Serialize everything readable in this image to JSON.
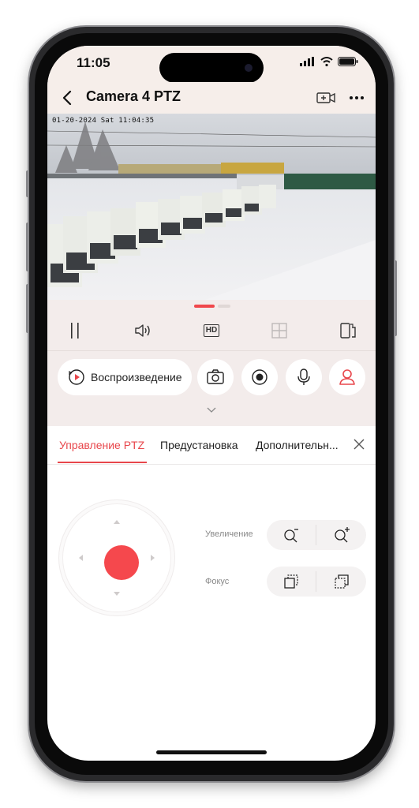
{
  "status_bar": {
    "time": "11:05"
  },
  "header": {
    "back_icon": "chevron-left-icon",
    "title": "Camera 4 PTZ",
    "video_add_icon": "video-plus-icon",
    "more_icon": "more-icon"
  },
  "video": {
    "osd_timestamp": "01-20-2024 Sat 11:04:35"
  },
  "toolbar": {
    "pause_icon": "pause-icon",
    "sound_icon": "speaker-icon",
    "quality_label": "HD",
    "split_icon": "grid-icon",
    "rotate_icon": "device-rotate-icon"
  },
  "actions": {
    "playback_label": "Воспроизведение",
    "screenshot_icon": "camera-icon",
    "record_icon": "record-icon",
    "mic_icon": "microphone-icon",
    "person_icon": "person-icon"
  },
  "tabs": [
    {
      "label": "Управление PTZ",
      "active": true
    },
    {
      "label": "Предустановка",
      "active": false
    },
    {
      "label": "Дополнительн...",
      "active": false
    }
  ],
  "ptz": {
    "zoom_label": "Увеличение",
    "focus_label": "Фокус"
  },
  "colors": {
    "accent": "#e8464b",
    "band_bg": "#f3eceb"
  }
}
